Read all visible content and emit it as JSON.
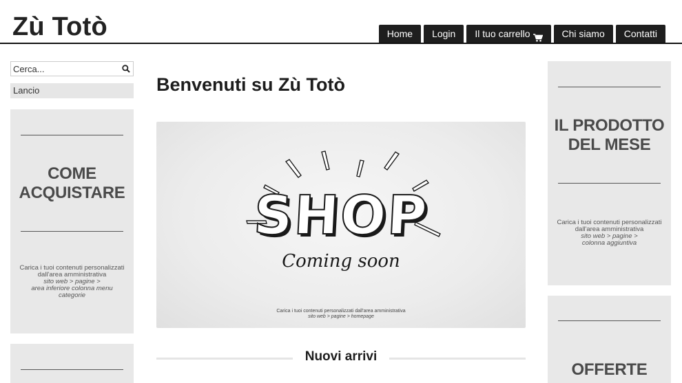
{
  "header": {
    "site_title": "Zù Totò",
    "nav": [
      {
        "label": "Home"
      },
      {
        "label": "Login"
      },
      {
        "label": "Il tuo carrello",
        "icon": "cart-icon"
      },
      {
        "label": "Chi siamo"
      },
      {
        "label": "Contatti"
      }
    ]
  },
  "left_sidebar": {
    "search": {
      "placeholder": "Cerca...",
      "icon": "search-icon"
    },
    "categories": [
      {
        "label": "Lancio"
      }
    ],
    "panel_how": {
      "title_line1": "COME",
      "title_line2": "ACQUISTARE",
      "caption_line1": "Carica i tuoi contenuti personalizzati",
      "caption_line2": "dall'area amministrativa",
      "caption_path1": "sito web > pagine >",
      "caption_path2": "area inferiore colonna menu",
      "caption_path3": "categorie"
    }
  },
  "main": {
    "title": "Benvenuti su Zù Totò",
    "hero": {
      "headline": "SHOP",
      "subline": "Coming soon",
      "caption_line1": "Carica i tuoi contenuti personalizzati dall'area amministrativa",
      "caption_path": "sito web > pagine > homepage"
    },
    "section_title": "Nuovi arrivi"
  },
  "right_sidebar": {
    "panel_product": {
      "title_line1": "IL PRODOTTO",
      "title_line2": "DEL MESE",
      "caption_line1": "Carica i tuoi contenuti personalizzati",
      "caption_line2": "dall'area amministrativa",
      "caption_path1": "sito web > pagine >",
      "caption_path2": "colonna aggiuntiva"
    },
    "panel_offers": {
      "title": "OFFERTE"
    }
  },
  "colors": {
    "nav_bg": "#1e1e1e",
    "panel_bg": "#e8e8e8",
    "header_rule": "#111111"
  }
}
